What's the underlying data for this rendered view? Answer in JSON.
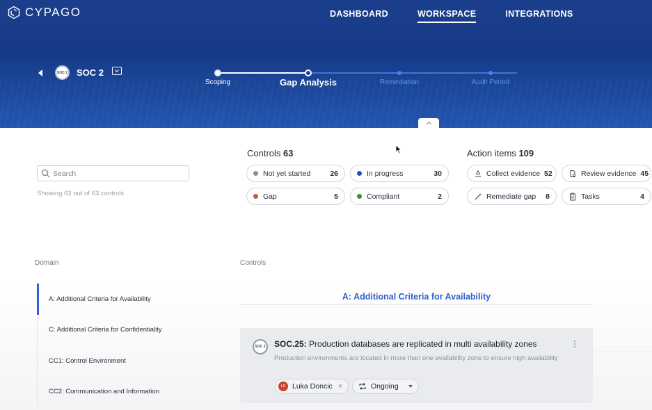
{
  "brand": {
    "name": "CYPAGO",
    "colors": {
      "header": "#1b3f8c",
      "accent": "#2f5fd0"
    }
  },
  "nav": [
    {
      "label": "DASHBOARD",
      "active": false
    },
    {
      "label": "WORKSPACE",
      "active": true
    },
    {
      "label": "INTEGRATIONS",
      "active": false
    }
  ],
  "framework": {
    "badge": "SOC 2",
    "name": "SOC 2"
  },
  "stepper": [
    {
      "label": "Scoping",
      "state": "done"
    },
    {
      "label": "Gap Analysis",
      "state": "current"
    },
    {
      "label": "Remediation",
      "state": "todo"
    },
    {
      "label": "Audit Period",
      "state": "todo"
    }
  ],
  "search": {
    "placeholder": "Search",
    "value": "",
    "showing": "Showing 63 out of 63 controls"
  },
  "controls": {
    "title": "Controls",
    "total": "63",
    "statuses": [
      {
        "label": "Not yet started",
        "count": "26",
        "color": "#8a8f98"
      },
      {
        "label": "In progress",
        "count": "30",
        "color": "#1f4fc4"
      },
      {
        "label": "Gap",
        "count": "5",
        "color": "#c8553d"
      },
      {
        "label": "Compliant",
        "count": "2",
        "color": "#3d8a3f"
      }
    ]
  },
  "action_items": {
    "title": "Action items",
    "total": "109",
    "items": [
      {
        "label": "Collect evidence",
        "count": "52",
        "icon": "collect-evidence-icon"
      },
      {
        "label": "Review evidence",
        "count": "45",
        "icon": "review-evidence-icon"
      },
      {
        "label": "Remediate gap",
        "count": "8",
        "icon": "magic-wand-icon"
      },
      {
        "label": "Tasks",
        "count": "4",
        "icon": "clipboard-icon"
      }
    ]
  },
  "columns": {
    "domain": "Domain",
    "controls": "Controls"
  },
  "domains": [
    {
      "label": "A: Additional Criteria for Availability",
      "active": true
    },
    {
      "label": "C: Additional Criteria for Confidentiality",
      "active": false
    },
    {
      "label": "CC1: Control Environment",
      "active": false
    },
    {
      "label": "CC2: Communication and Information",
      "active": false
    }
  ],
  "section": {
    "title": "A: Additional Criteria for Availability"
  },
  "control_card": {
    "badge": "SOC 2",
    "id": "SOC.25:",
    "title": "Production databases are replicated in multi availability zones",
    "description": "Production environments are located in more than one availability zone to ensure high availability",
    "owner": {
      "name": "Luka Doncic",
      "initials": "LD"
    },
    "status": "Ongoing"
  }
}
